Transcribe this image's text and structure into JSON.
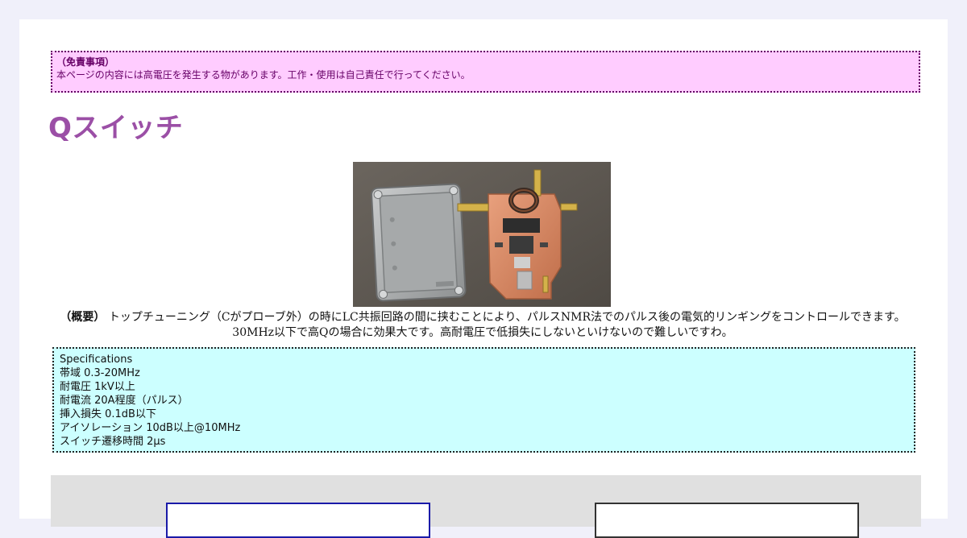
{
  "disclaimer": {
    "title": "（免責事項）",
    "text": "本ページの内容には高電圧を発生する物があります。工作・使用は自己責任で行ってください。"
  },
  "page_title": "Qスイッチ",
  "summary": {
    "label": "（概要）",
    "line1": "トップチューニング（Cがプローブ外）の時にLC共振回路の間に挟むことにより、パルスNMR法でのパルス後の電気的リンギングをコントロールできます。",
    "line2": "30MHz以下で高Qの場合に効果大です。高耐電圧で低損失にしないといけないので難しいですわ。"
  },
  "specs": {
    "heading": "Specifications",
    "items": [
      "帯域 0.3-20MHz",
      "耐電圧 1kV以上",
      "耐電流 20A程度（パルス）",
      "挿入損失 0.1dB以下",
      "アイソレーション 10dB以上@10MHz",
      "スイッチ遷移時間 2μs"
    ]
  },
  "colors": {
    "disclaimer_bg": "#ffccff",
    "disclaimer_text": "#660066",
    "title": "#9b4fa6",
    "specs_bg": "#ccffff"
  }
}
